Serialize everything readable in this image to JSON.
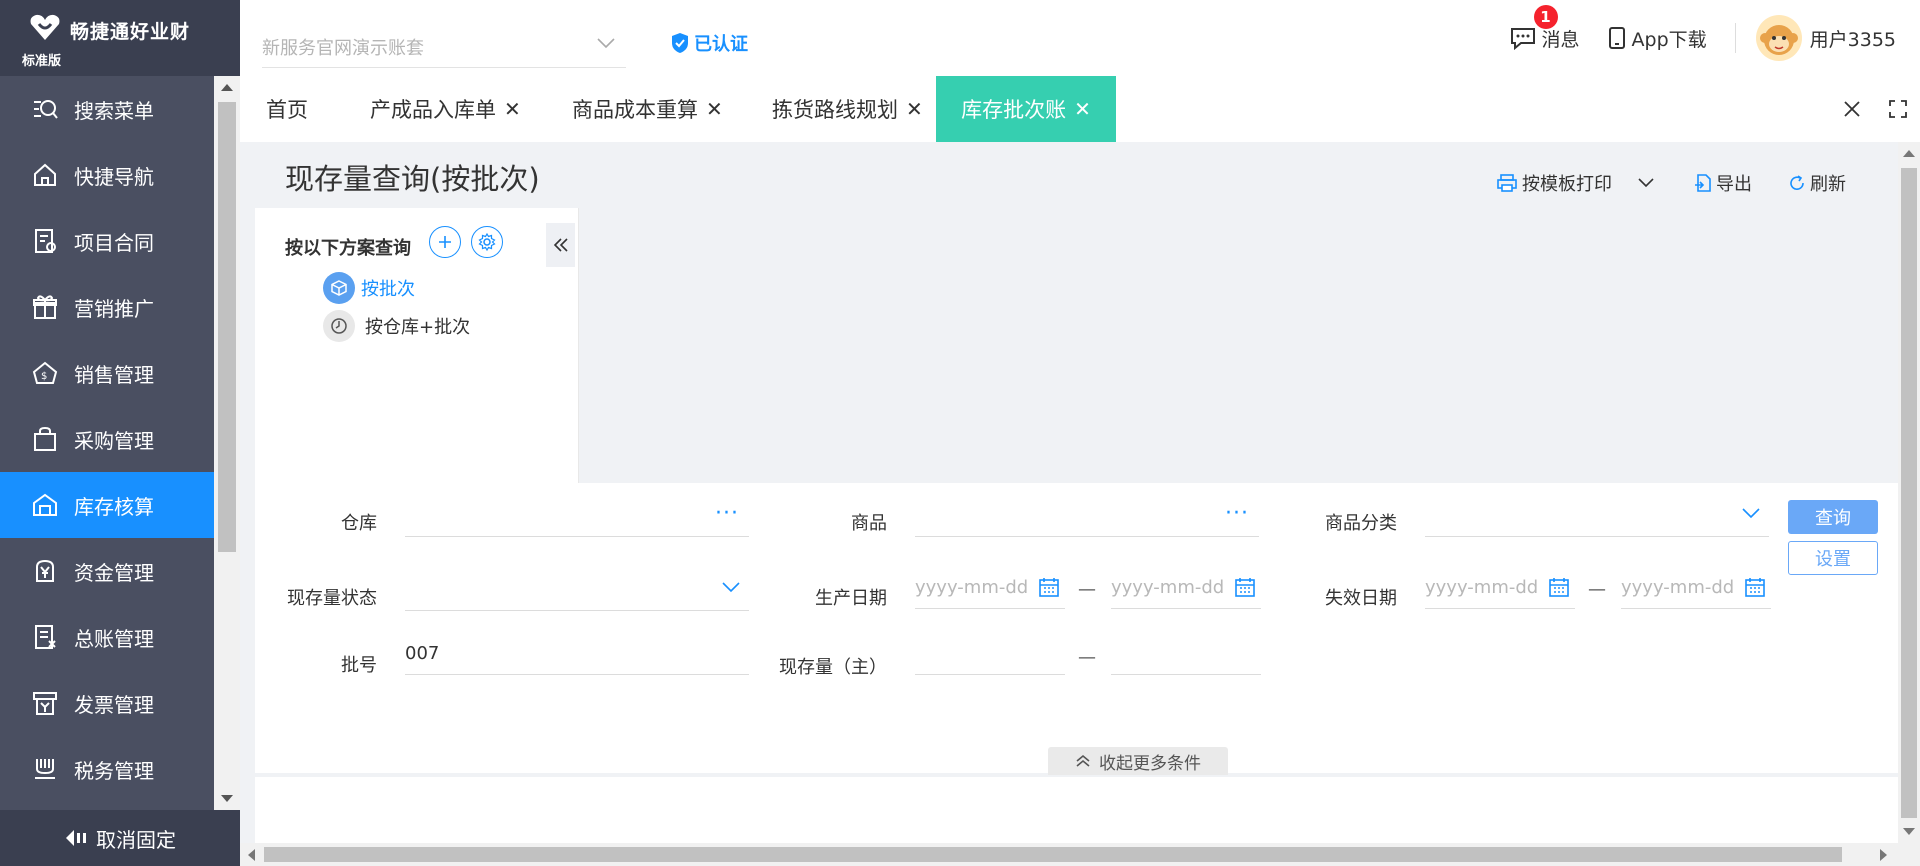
{
  "brand": {
    "name": "畅捷通好业财",
    "edition": "标准版"
  },
  "sidebar": {
    "items": [
      {
        "label": "搜索菜单",
        "icon": "search-menu-icon"
      },
      {
        "label": "快捷导航",
        "icon": "home-icon"
      },
      {
        "label": "项目合同",
        "icon": "contract-icon"
      },
      {
        "label": "营销推广",
        "icon": "gift-icon"
      },
      {
        "label": "销售管理",
        "icon": "sales-icon"
      },
      {
        "label": "采购管理",
        "icon": "bag-icon"
      },
      {
        "label": "库存核算",
        "icon": "warehouse-icon"
      },
      {
        "label": "资金管理",
        "icon": "yen-icon"
      },
      {
        "label": "总账管理",
        "icon": "ledger-icon"
      },
      {
        "label": "发票管理",
        "icon": "invoice-icon"
      },
      {
        "label": "税务管理",
        "icon": "tax-icon"
      }
    ],
    "active_index": 6,
    "unpin_label": "取消固定"
  },
  "header": {
    "account_placeholder": "新服务官网演示账套",
    "certified": "已认证",
    "messages_label": "消息",
    "messages_count": "1",
    "app_download": "App下载",
    "username": "用户3355"
  },
  "tabs": [
    {
      "label": "首页",
      "closable": false
    },
    {
      "label": "产成品入库单",
      "closable": true
    },
    {
      "label": "商品成本重算",
      "closable": true
    },
    {
      "label": "拣货路线规划",
      "closable": true
    },
    {
      "label": "库存批次账",
      "closable": true,
      "active": true
    }
  ],
  "close_symbol": "✕",
  "page": {
    "title": "现存量查询(按批次)",
    "toolbar": {
      "print": "按模板打印",
      "export": "导出",
      "refresh": "刷新"
    }
  },
  "schemes": {
    "title": "按以下方案查询",
    "items": [
      {
        "label": "按批次",
        "selected": true
      },
      {
        "label": "按仓库+批次",
        "selected": false
      }
    ]
  },
  "filters": {
    "warehouse_label": "仓库",
    "warehouse_value": "",
    "product_label": "商品",
    "product_value": "",
    "category_label": "商品分类",
    "stock_status_label": "现存量状态",
    "production_date_label": "生产日期",
    "expiry_date_label": "失效日期",
    "date_placeholder": "yyyy-mm-dd",
    "range_dash": "—",
    "batch_label": "批号",
    "batch_value": "007",
    "qty_label": "现存量（主）",
    "ellipsis": "···",
    "fold_label": "收起更多条件",
    "query_button": "查询",
    "settings_button": "设置"
  },
  "colors": {
    "sidebar": "#4a4f61",
    "active_menu": "#1890ff",
    "active_tab": "#36cfb0",
    "primary": "#1890ff"
  }
}
